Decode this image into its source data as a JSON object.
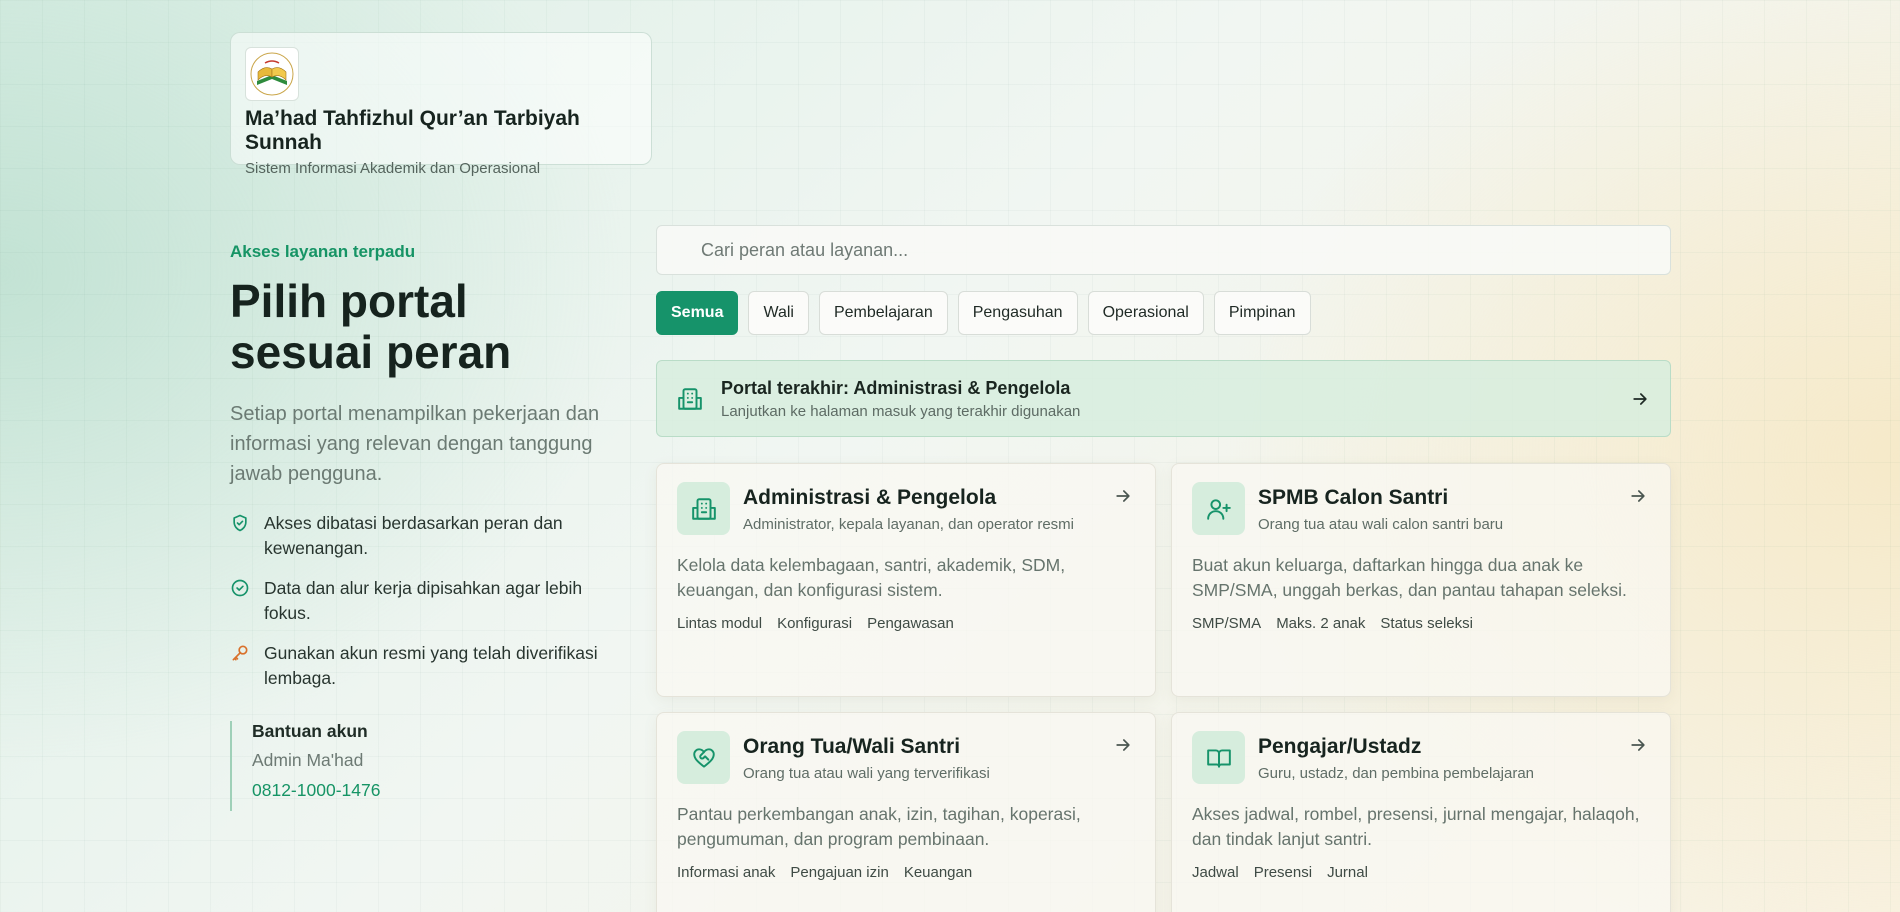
{
  "brand": {
    "title": "Ma’had Tahfizhul Qur’an Tarbiyah Sunnah",
    "subtitle": "Sistem Informasi Akademik dan Operasional"
  },
  "intro": {
    "eyebrow": "Akses layanan terpadu",
    "heading": "Pilih portal sesuai peran",
    "lead": "Setiap portal menampilkan pekerjaan dan informasi yang relevan dengan tanggung jawab pengguna.",
    "bullets": [
      {
        "icon": "shield-check-icon",
        "text": "Akses dibatasi berdasarkan peran dan kewenangan."
      },
      {
        "icon": "check-circle-icon",
        "text": "Data dan alur kerja dipisahkan agar lebih fokus."
      },
      {
        "icon": "key-icon",
        "text": "Gunakan akun resmi yang telah diverifikasi lembaga."
      }
    ]
  },
  "help": {
    "title": "Bantuan akun",
    "name": "Admin Ma'had",
    "phone": "0812-1000-1476"
  },
  "search": {
    "placeholder": "Cari peran atau layanan..."
  },
  "filters": [
    "Semua",
    "Wali",
    "Pembelajaran",
    "Pengasuhan",
    "Operasional",
    "Pimpinan"
  ],
  "active_filter": "Semua",
  "recent": {
    "title": "Portal terakhir: Administrasi & Pengelola",
    "subtitle": "Lanjutkan ke halaman masuk yang terakhir digunakan"
  },
  "portals": [
    {
      "icon": "building-icon",
      "title": "Administrasi & Pengelola",
      "subtitle": "Administrator, kepala layanan, dan operator resmi",
      "description": "Kelola data kelembagaan, santri, akademik, SDM, keuangan, dan konfigurasi sistem.",
      "tags": [
        "Lintas modul",
        "Konfigurasi",
        "Pengawasan"
      ]
    },
    {
      "icon": "user-plus-icon",
      "title": "SPMB Calon Santri",
      "subtitle": "Orang tua atau wali calon santri baru",
      "description": "Buat akun keluarga, daftarkan hingga dua anak ke SMP/SMA, unggah berkas, dan pantau tahapan seleksi.",
      "tags": [
        "SMP/SMA",
        "Maks. 2 anak",
        "Status seleksi"
      ]
    },
    {
      "icon": "heart-handshake-icon",
      "title": "Orang Tua/Wali Santri",
      "subtitle": "Orang tua atau wali yang terverifikasi",
      "description": "Pantau perkembangan anak, izin, tagihan, koperasi, pengumuman, dan program pembinaan.",
      "tags": [
        "Informasi anak",
        "Pengajuan izin",
        "Keuangan"
      ]
    },
    {
      "icon": "book-open-icon",
      "title": "Pengajar/Ustadz",
      "subtitle": "Guru, ustadz, dan pembina pembelajaran",
      "description": "Akses jadwal, rombel, presensi, jurnal mengajar, halaqoh, dan tindak lanjut santri.",
      "tags": [
        "Jadwal",
        "Presensi",
        "Jurnal"
      ]
    }
  ],
  "colors": {
    "accent": "#16936a",
    "accent_soft": "#d6eddd",
    "text": "#17241f",
    "key_icon": "#d9712b"
  }
}
